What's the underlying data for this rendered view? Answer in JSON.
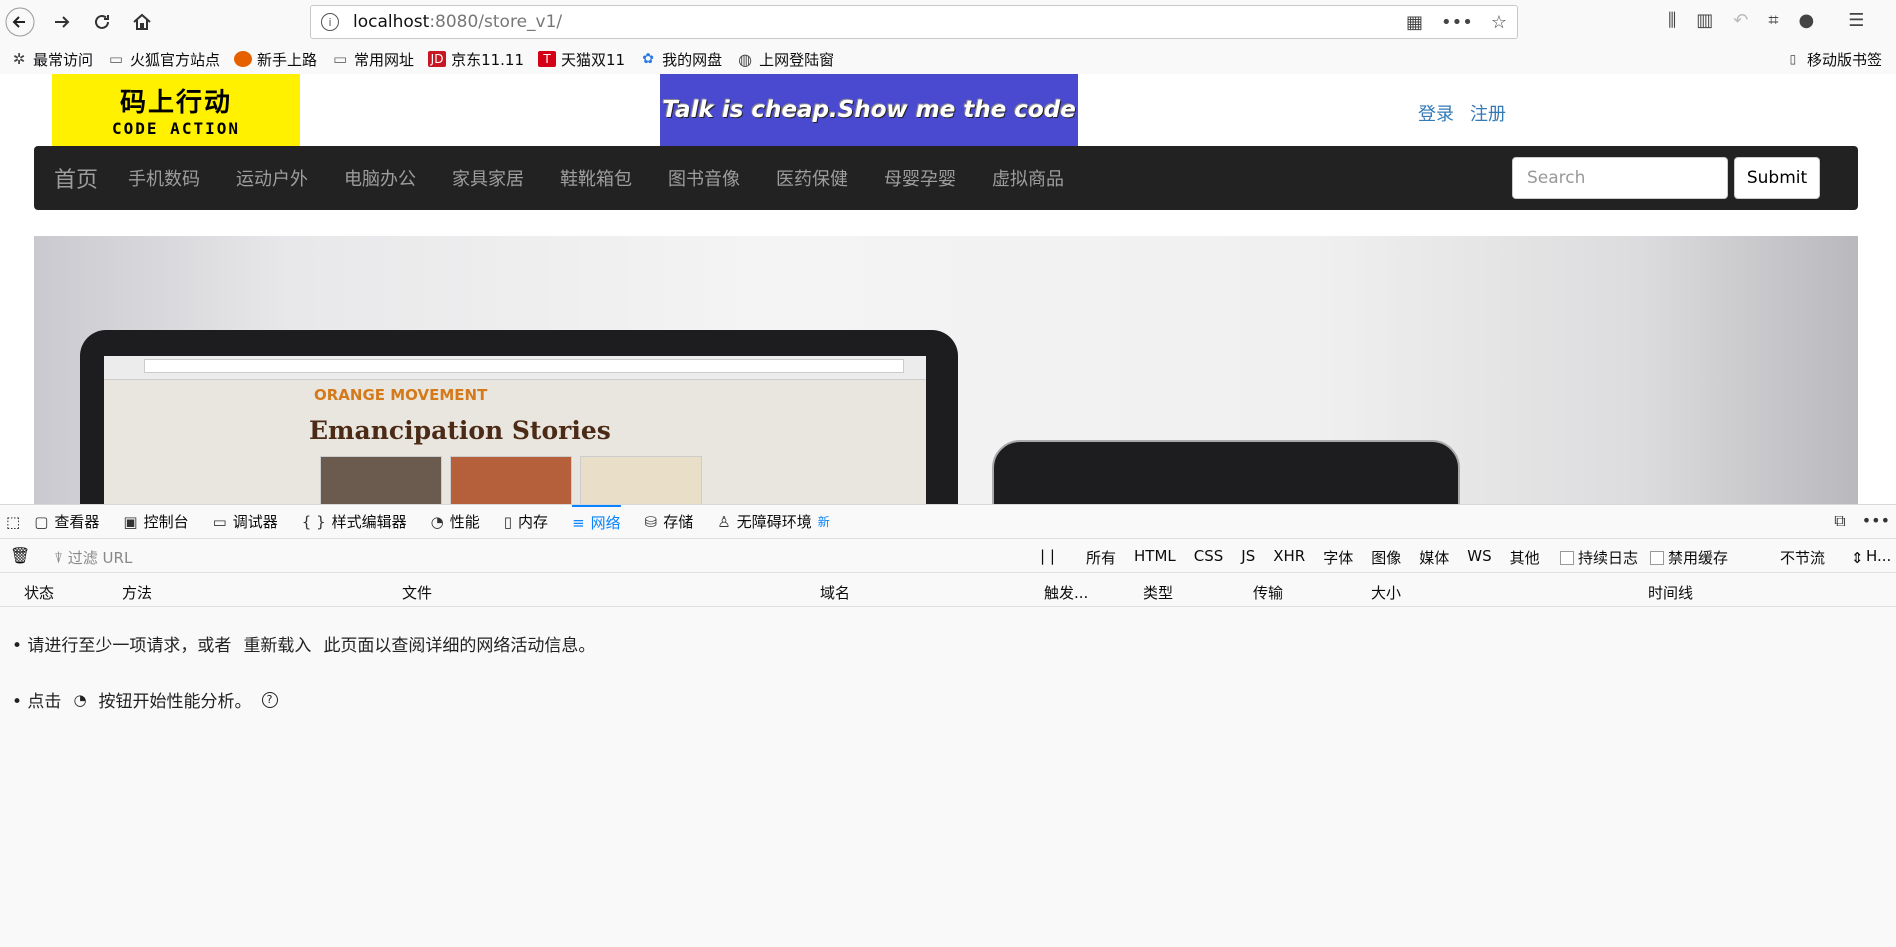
{
  "browser": {
    "url_host": "localhost",
    "url_path": ":8080/store_v1/",
    "bookmarks": [
      "最常访问",
      "火狐官方站点",
      "新手上路",
      "常用网址",
      "京东11.11",
      "天猫双11",
      "我的网盘",
      "上网登陆窗"
    ],
    "mobile_bookmarks": "移动版书签"
  },
  "site": {
    "logo_cn": "码上行动",
    "logo_en": "CODE ACTION",
    "banner": "Talk is cheap.Show me the code",
    "login": "登录",
    "register": "注册",
    "nav_brand": "首页",
    "nav_items": [
      "手机数码",
      "运动户外",
      "电脑办公",
      "家具家居",
      "鞋靴箱包",
      "图书音像",
      "医药保健",
      "母婴孕婴",
      "虚拟商品"
    ],
    "search_placeholder": "Search",
    "submit": "Submit",
    "hero_heading": "Emancipation Stories",
    "hero_brand": "ORANGE MOVEMENT"
  },
  "devtools": {
    "tabs": [
      "查看器",
      "控制台",
      "调试器",
      "样式编辑器",
      "性能",
      "内存",
      "网络",
      "存储",
      "无障碍环境"
    ],
    "new_badge": "新",
    "filter_placeholder": "过滤 URL",
    "types": [
      "所有",
      "HTML",
      "CSS",
      "JS",
      "XHR",
      "字体",
      "图像",
      "媒体",
      "WS",
      "其他"
    ],
    "persist_log": "持续日志",
    "disable_cache": "禁用缓存",
    "throttle": "不节流",
    "har": "H...",
    "columns": [
      "状态",
      "方法",
      "文件",
      "域名",
      "触发...",
      "类型",
      "传输",
      "大小",
      "时间线"
    ],
    "msg1_a": "• 请进行至少一项请求，或者",
    "msg1_btn": "重新载入",
    "msg1_b": "此页面以查阅详细的网络活动信息。",
    "msg2_a": "• 点击",
    "msg2_b": "按钮开始性能分析。"
  }
}
